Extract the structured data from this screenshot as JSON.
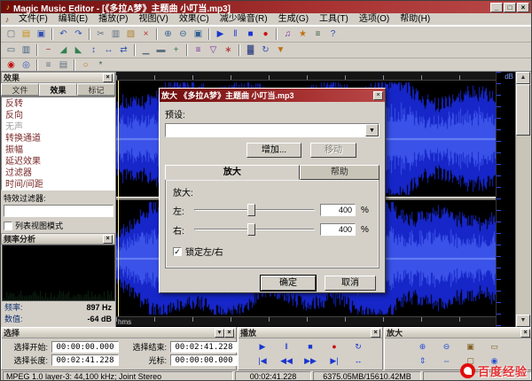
{
  "window": {
    "title": "Magic Music Editor - [《多拉A梦》主题曲 小叮当.mp3]",
    "controls": {
      "minimize": "_",
      "maximize": "□",
      "close": "×"
    }
  },
  "menu": {
    "items": [
      "文件(F)",
      "编辑(E)",
      "播放(P)",
      "视图(V)",
      "效果(C)",
      "减少噪音(R)",
      "生成(G)",
      "工具(T)",
      "选项(O)",
      "帮助(H)"
    ]
  },
  "toolbars": {
    "row1": [
      {
        "name": "new-file-icon",
        "glyph": "▢",
        "color": "#607080"
      },
      {
        "name": "open-folder-icon",
        "glyph": "▤",
        "color": "#c89018"
      },
      {
        "name": "save-icon",
        "glyph": "▣",
        "color": "#3050b0"
      },
      {
        "sep": true
      },
      {
        "name": "undo-icon",
        "glyph": "↶",
        "color": "#3050b0"
      },
      {
        "name": "redo-icon",
        "glyph": "↷",
        "color": "#3050b0"
      },
      {
        "sep": true
      },
      {
        "name": "cut-icon",
        "glyph": "✂",
        "color": "#607080"
      },
      {
        "name": "copy-icon",
        "glyph": "▥",
        "color": "#607080"
      },
      {
        "name": "paste-icon",
        "glyph": "▧",
        "color": "#b08030"
      },
      {
        "name": "delete-icon",
        "glyph": "×",
        "color": "#c03030"
      },
      {
        "sep": true
      },
      {
        "name": "zoom-in-icon",
        "glyph": "⊕",
        "color": "#306090"
      },
      {
        "name": "zoom-out-icon",
        "glyph": "⊖",
        "color": "#306090"
      },
      {
        "name": "zoom-selection-icon",
        "glyph": "▣",
        "color": "#306090"
      },
      {
        "sep": true
      },
      {
        "name": "play-icon",
        "glyph": "▶",
        "color": "#1a35d0"
      },
      {
        "name": "pause-icon",
        "glyph": "‖",
        "color": "#1a35d0"
      },
      {
        "name": "stop-icon",
        "glyph": "■",
        "color": "#1a35d0"
      },
      {
        "name": "record-icon",
        "glyph": "●",
        "color": "#cc1111"
      },
      {
        "sep": true
      },
      {
        "name": "mix-icon",
        "glyph": "♫",
        "color": "#8030a0"
      },
      {
        "name": "effects-icon",
        "glyph": "★",
        "color": "#c07010"
      },
      {
        "name": "properties-icon",
        "glyph": "≡",
        "color": "#406040"
      },
      {
        "name": "help-icon",
        "glyph": "?",
        "color": "#3050b0"
      }
    ],
    "row2": [
      {
        "name": "select-all-icon",
        "glyph": "▭",
        "color": "#406080"
      },
      {
        "name": "selection-tool-icon",
        "glyph": "▥",
        "color": "#406080"
      },
      {
        "sep": true
      },
      {
        "name": "amplify-icon",
        "glyph": "~",
        "color": "#b03030"
      },
      {
        "name": "fade-in-icon",
        "glyph": "◢",
        "color": "#308050"
      },
      {
        "name": "fade-out-icon",
        "glyph": "◣",
        "color": "#308050"
      },
      {
        "name": "normalize-icon",
        "glyph": "↕",
        "color": "#3050b0"
      },
      {
        "name": "reverse-icon",
        "glyph": "↔",
        "color": "#3050b0"
      },
      {
        "name": "swap-channels-icon",
        "glyph": "⇄",
        "color": "#3050b0"
      },
      {
        "sep": true
      },
      {
        "name": "silence-icon",
        "glyph": "▁",
        "color": "#607080"
      },
      {
        "name": "trim-icon",
        "glyph": "▬",
        "color": "#607080"
      },
      {
        "name": "insert-icon",
        "glyph": "+",
        "color": "#308050"
      },
      {
        "sep": true
      },
      {
        "name": "equalizer-icon",
        "glyph": "≡",
        "color": "#8030a0"
      },
      {
        "name": "filter-icon",
        "glyph": "▽",
        "color": "#8030a0"
      },
      {
        "name": "noise-reduction-icon",
        "glyph": "∗",
        "color": "#b03030"
      },
      {
        "sep": true
      },
      {
        "name": "spectrum-icon",
        "glyph": "▓",
        "color": "#304080"
      },
      {
        "name": "loop-icon",
        "glyph": "↻",
        "color": "#3050b0"
      },
      {
        "name": "marker-icon",
        "glyph": "▼",
        "color": "#c07010"
      }
    ],
    "row3": [
      {
        "name": "record-level-icon",
        "glyph": "◉",
        "color": "#c01010"
      },
      {
        "name": "monitor-icon",
        "glyph": "◎",
        "color": "#3050b0"
      },
      {
        "sep": true
      },
      {
        "name": "script-list-icon",
        "glyph": "≡",
        "color": "#607080"
      },
      {
        "name": "batch-icon",
        "glyph": "▤",
        "color": "#607080"
      },
      {
        "sep": true
      },
      {
        "name": "cd-icon",
        "glyph": "○",
        "color": "#c07010"
      },
      {
        "name": "options-icon",
        "glyph": "*",
        "color": "#406040"
      }
    ]
  },
  "left_panel": {
    "header": "效果",
    "tabs": [
      {
        "label": "文件",
        "active": false
      },
      {
        "label": "效果",
        "active": true
      },
      {
        "label": "标记",
        "active": false
      }
    ],
    "effects": [
      {
        "label": "反转"
      },
      {
        "label": "反向"
      },
      {
        "label": "无声",
        "disabled": true
      },
      {
        "label": "转换通道"
      },
      {
        "label": "振幅"
      },
      {
        "label": "延迟效果"
      },
      {
        "label": "过滤器"
      },
      {
        "label": "时间/间距"
      }
    ],
    "filter_label": "特效过滤器:",
    "filter_value": "",
    "list_mode_label": "列表视图模式",
    "freq_panel": {
      "header": "频率分析",
      "freq_label": "频率:",
      "freq_value": "897 Hz",
      "level_label": "数值:",
      "level_value": "-64 dB"
    }
  },
  "waveform": {
    "time_unit": "hms",
    "db_unit": "dB"
  },
  "dialog": {
    "title": "放大  《多拉A梦》主题曲 小叮当.mp3",
    "close": "×",
    "preset_label": "预设:",
    "preset_value": "",
    "add_button": "增加...",
    "move_button": "移动",
    "tabs": [
      {
        "label": "放大",
        "active": true
      },
      {
        "label": "帮助",
        "active": false
      }
    ],
    "group_label": "放大:",
    "left_label": "左:",
    "left_value": "400",
    "left_unit": "%",
    "right_label": "右:",
    "right_value": "400",
    "right_unit": "%",
    "lock_label": "锁定左/右",
    "ok": "确定",
    "cancel": "取消"
  },
  "select_panel": {
    "header": "选择",
    "start_label": "选择开始:",
    "start_value": "00:00:00.000",
    "end_label": "选择结束:",
    "end_value": "00:02:41.228",
    "length_label": "选择长度:",
    "length_value": "00:02:41.228",
    "cursor_label": "光标:",
    "cursor_value": "00:00:00.000"
  },
  "play_panel": {
    "header": "播放",
    "row1": [
      {
        "name": "play-button",
        "glyph": "▶",
        "color": "#1a35d0"
      },
      {
        "name": "pause-button",
        "glyph": "‖",
        "color": "#1a35d0"
      },
      {
        "name": "stop-button",
        "glyph": "■",
        "color": "#1a35d0"
      },
      {
        "name": "record-button",
        "glyph": "●",
        "color": "#cc1111"
      },
      {
        "name": "loop-button",
        "glyph": "↻",
        "color": "#1a35d0"
      }
    ],
    "row2": [
      {
        "name": "go-start-button",
        "glyph": "|◀",
        "color": "#1a35d0"
      },
      {
        "name": "rewind-button",
        "glyph": "◀◀",
        "color": "#1a35d0"
      },
      {
        "name": "forward-button",
        "glyph": "▶▶",
        "color": "#1a35d0"
      },
      {
        "name": "go-end-button",
        "glyph": "▶|",
        "color": "#1a35d0"
      },
      {
        "name": "play-selection-button",
        "glyph": "↔",
        "color": "#1a35d0"
      }
    ]
  },
  "zoom_panel": {
    "header": "放大",
    "row1": [
      {
        "name": "zoom-in-button",
        "glyph": "⊕",
        "color": "#2a4fd0"
      },
      {
        "name": "zoom-out-button",
        "glyph": "⊖",
        "color": "#2a4fd0"
      },
      {
        "name": "zoom-selection-button",
        "glyph": "▣",
        "color": "#806020"
      },
      {
        "name": "zoom-full-button",
        "glyph": "▭",
        "color": "#806020"
      }
    ],
    "row2": [
      {
        "name": "zoom-vertical-button",
        "glyph": "⇕",
        "color": "#2a4fd0"
      },
      {
        "name": "zoom-horizontal-button",
        "glyph": "⇔",
        "color": "#2a4fd0"
      },
      {
        "name": "zoom-restore-button",
        "glyph": "▢",
        "color": "#806020"
      },
      {
        "name": "zoom-level-button",
        "glyph": "◉",
        "color": "#2a4fd0"
      }
    ]
  },
  "status_bar": {
    "format": "MPEG 1.0 layer-3: 44,100 kHz; Joint Stereo",
    "time": "00:02:41.228",
    "size": "6375.05MB/15610.42MB"
  },
  "watermark": {
    "text": "百度经验"
  }
}
